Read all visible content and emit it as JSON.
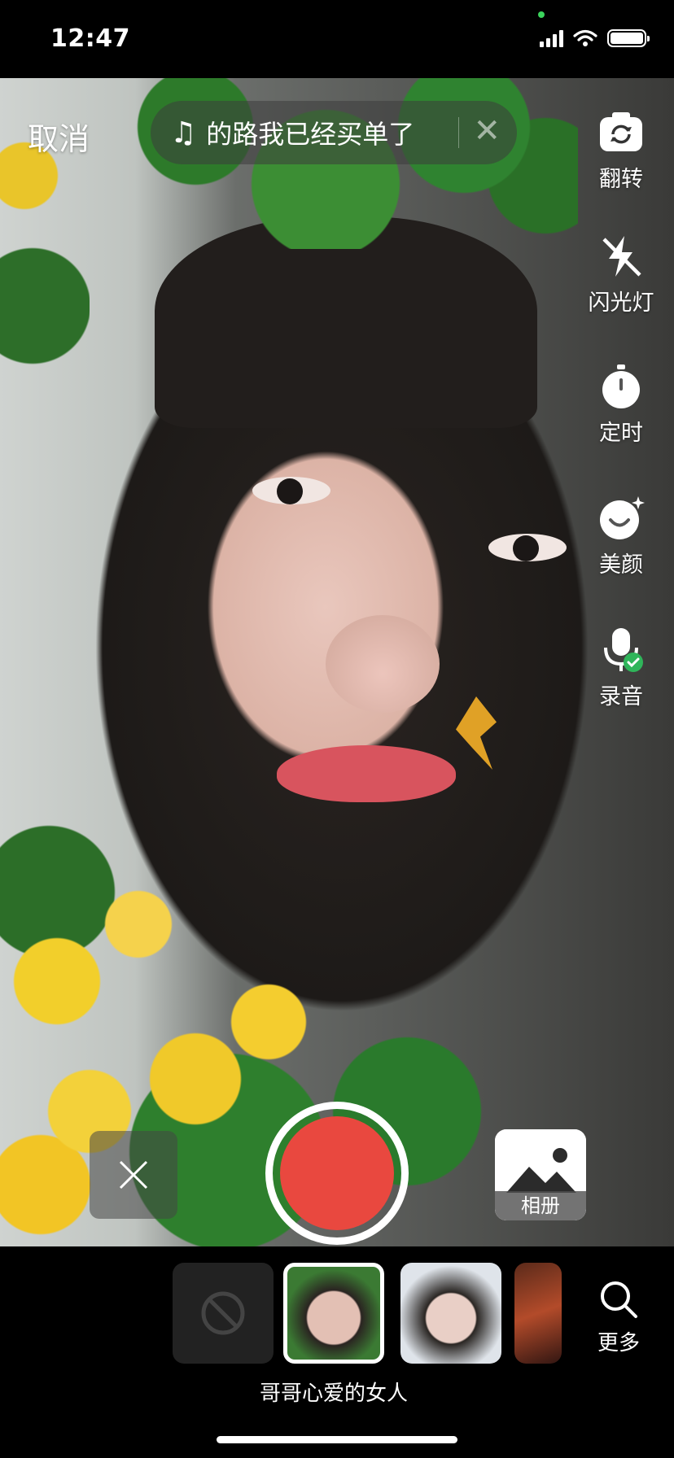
{
  "status_bar": {
    "time": "12:47"
  },
  "top_bar": {
    "cancel_label": "取消",
    "music_title": "的路我已经买单了",
    "music_icon": "♫"
  },
  "right_tools": [
    {
      "label": "翻转",
      "icon": "flip-camera-icon"
    },
    {
      "label": "闪光灯",
      "icon": "flash-off-icon"
    },
    {
      "label": "定时",
      "icon": "timer-icon"
    },
    {
      "label": "美颜",
      "icon": "beauty-icon"
    },
    {
      "label": "录音",
      "icon": "microphone-icon"
    }
  ],
  "bottom_controls": {
    "album_label": "相册",
    "record_color": "#e9483f"
  },
  "effects_bar": {
    "selected_effect_name": "哥哥心爱的女人",
    "more_label": "更多"
  }
}
